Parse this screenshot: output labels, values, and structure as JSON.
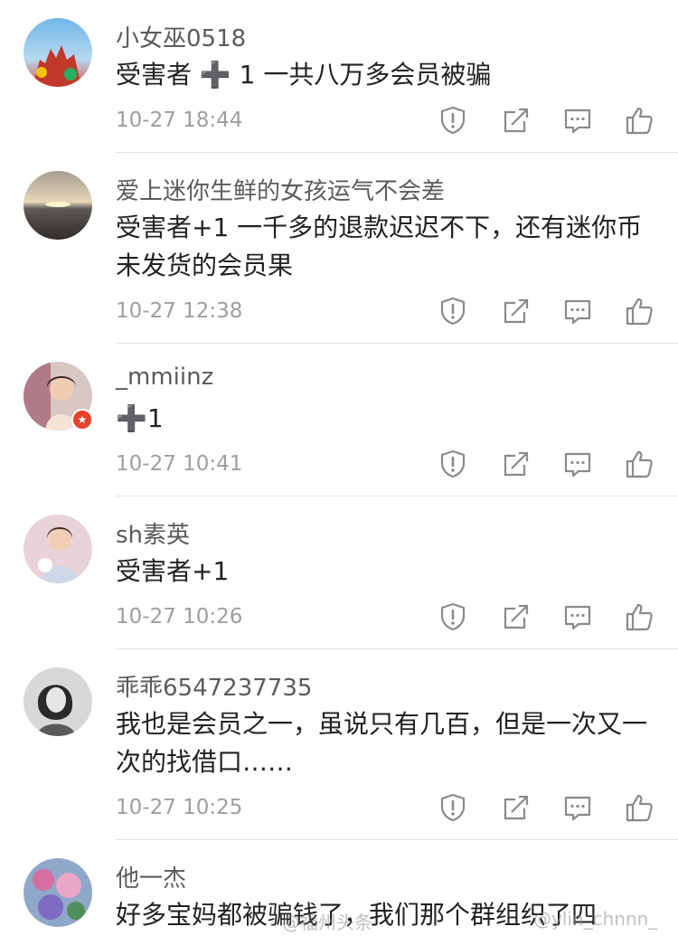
{
  "comments": [
    {
      "username": "小女巫0518",
      "text": "受害者 ➕ 1 一共八万多会员被骗",
      "time": "10-27 18:44"
    },
    {
      "username": "爱上迷你生鲜的女孩运气不会差",
      "text": "受害者+1 一千多的退款迟迟不下，还有迷你币 未发货的会员果",
      "time": "10-27 12:38"
    },
    {
      "username": "_mmiinz",
      "text": "➕1",
      "time": "10-27 10:41"
    },
    {
      "username": "sh素英",
      "text": "受害者+1",
      "time": "10-27 10:26"
    },
    {
      "username": "乖乖6547237735",
      "text": "我也是会员之一，虽说只有几百，但是一次又一次的找借口……",
      "time": "10-27 10:25"
    },
    {
      "username": "他一杰",
      "text": "好多宝妈都被骗钱了，我们那个群组织了四"
    }
  ],
  "watermark": {
    "left": "@福州头条",
    "right": "@ylin_chnnn_"
  },
  "icons": {
    "report": "report-icon",
    "share": "share-icon",
    "reply": "comment-icon",
    "like": "thumbs-up-icon",
    "verified": "verified-badge-icon"
  },
  "colors": {
    "username": "#5b5b5b",
    "text": "#222222",
    "time": "#9e9e9e",
    "icon": "#8a8a8a",
    "badge": "#e8412c"
  }
}
